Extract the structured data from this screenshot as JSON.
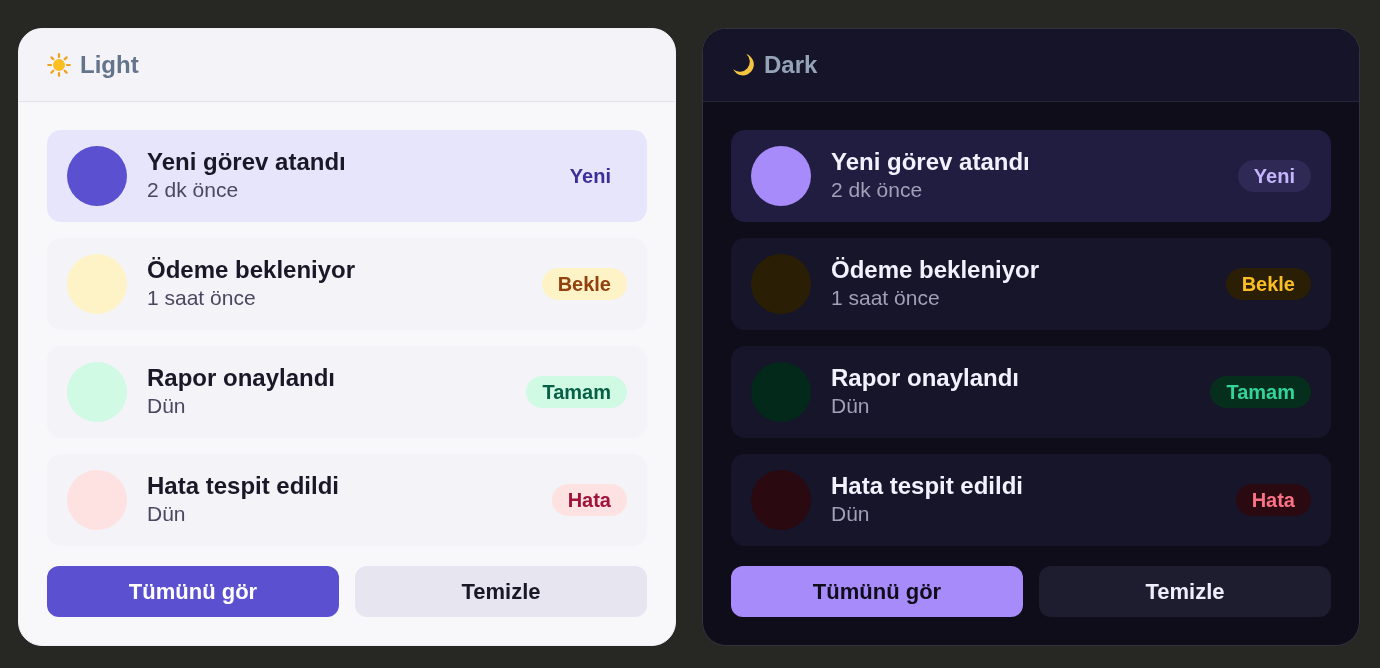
{
  "panels": [
    {
      "kind": "light",
      "title": "Light",
      "notifications": [
        {
          "title": "Yeni görev atandı",
          "time": "2 dk önce",
          "badge": "Yeni",
          "kind": "new",
          "unread": true,
          "color": "#5b50d0"
        },
        {
          "title": "Ödeme bekleniyor",
          "time": "1 saat önce",
          "badge": "Bekle",
          "kind": "pending",
          "unread": false,
          "color": "#fef3c7"
        },
        {
          "title": "Rapor onaylandı",
          "time": "Dün",
          "badge": "Tamam",
          "kind": "done",
          "unread": false,
          "color": "#d1fae5"
        },
        {
          "title": "Hata tespit edildi",
          "time": "Dün",
          "badge": "Hata",
          "kind": "error",
          "unread": false,
          "color": "#fee2e2"
        }
      ],
      "buttons": [
        {
          "label": "Tümünü gör",
          "kind": "primary"
        },
        {
          "label": "Temizle",
          "kind": "secondary"
        }
      ]
    },
    {
      "kind": "dark",
      "title": "Dark",
      "notifications": [
        {
          "title": "Yeni görev atandı",
          "time": "2 dk önce",
          "badge": "Yeni",
          "kind": "new",
          "unread": true,
          "color": "#a78bfa"
        },
        {
          "title": "Ödeme bekleniyor",
          "time": "1 saat önce",
          "badge": "Bekle",
          "kind": "pending",
          "unread": false,
          "color": "#2a1f05"
        },
        {
          "title": "Rapor onaylandı",
          "time": "Dün",
          "badge": "Tamam",
          "kind": "done",
          "unread": false,
          "color": "#03291a"
        },
        {
          "title": "Hata tespit edildi",
          "time": "Dün",
          "badge": "Hata",
          "kind": "error",
          "unread": false,
          "color": "#2a0a10"
        }
      ],
      "buttons": [
        {
          "label": "Tümünü gör",
          "kind": "primary"
        },
        {
          "label": "Temizle",
          "kind": "secondary"
        }
      ]
    }
  ]
}
